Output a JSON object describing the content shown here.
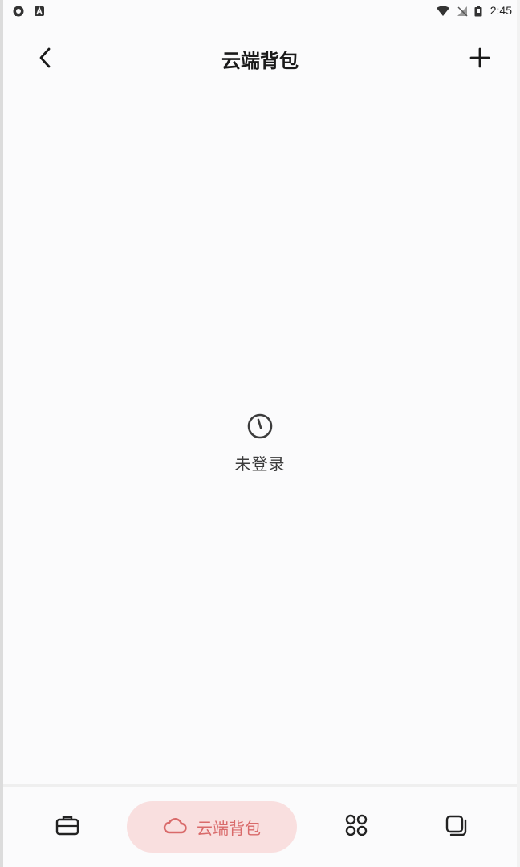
{
  "status_bar": {
    "time": "2:45",
    "left_icons": [
      "chat-bubble-icon",
      "app-a-icon"
    ],
    "right_icons": [
      "wifi-icon",
      "no-signal-icon",
      "battery-icon"
    ]
  },
  "header": {
    "title": "云端背包",
    "back_icon": "chevron-left-icon",
    "add_icon": "plus-icon"
  },
  "empty_state": {
    "icon": "clock-icon",
    "label": "未登录"
  },
  "bottom_nav": {
    "items": [
      {
        "icon": "briefcase-icon",
        "label": ""
      },
      {
        "icon": "cloud-icon",
        "label": "云端背包",
        "active": true
      },
      {
        "icon": "grid-icon",
        "label": ""
      },
      {
        "icon": "layers-icon",
        "label": ""
      }
    ]
  },
  "colors": {
    "accent_text": "#d96a6a",
    "accent_bg": "#f9dfdf",
    "background": "#fbfbfc"
  }
}
